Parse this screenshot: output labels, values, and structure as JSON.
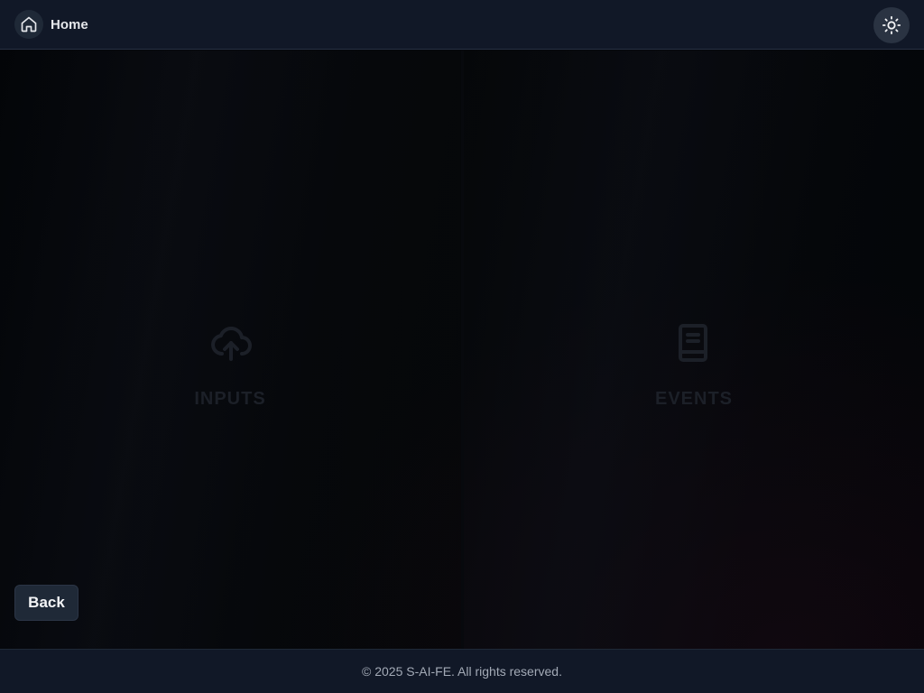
{
  "header": {
    "home_label": "Home",
    "home_icon": "home-icon",
    "theme_icon": "sun-icon"
  },
  "panels": [
    {
      "title": "INPUTS",
      "icon": "cloud-upload-icon"
    },
    {
      "title": "EVENTS",
      "icon": "book-icon"
    }
  ],
  "actions": {
    "back_label": "Back"
  },
  "footer": {
    "copyright": "© 2025 S-AI-FE. All rights reserved."
  },
  "colors": {
    "header_bg": "#111827",
    "button_bg": "#1f2937",
    "page_bg": "#05070b"
  }
}
